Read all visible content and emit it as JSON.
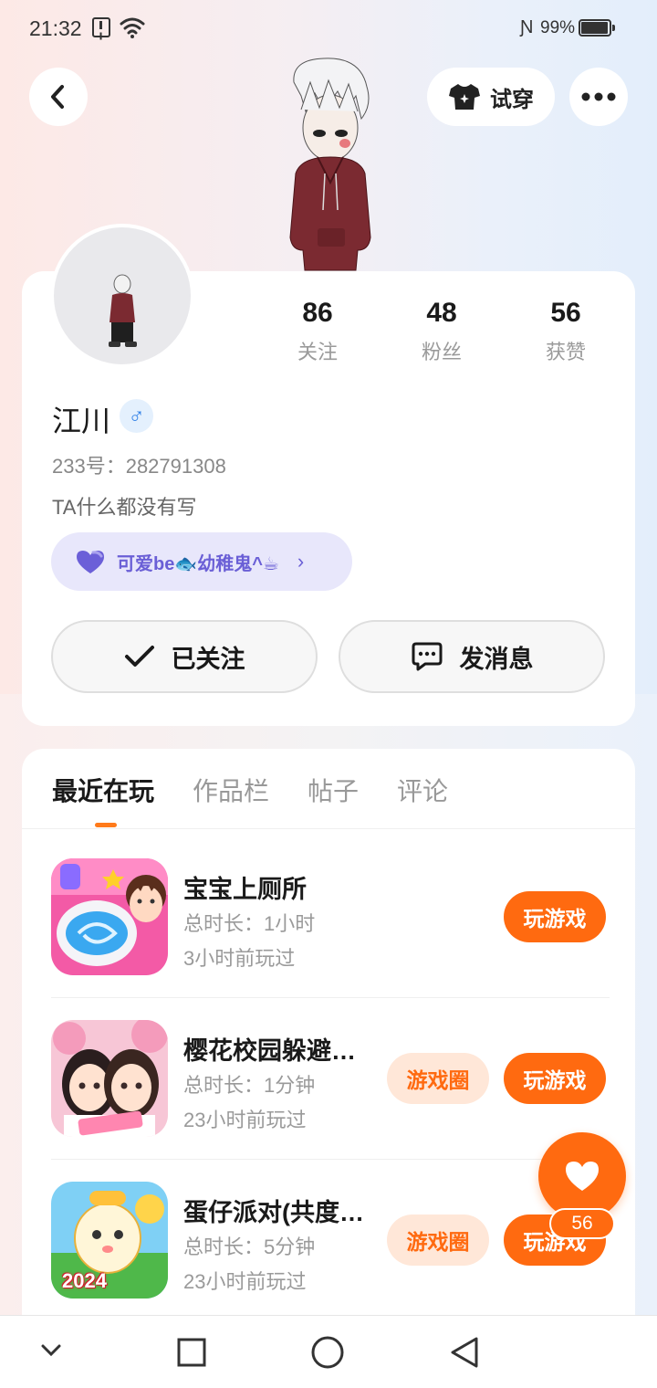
{
  "status_bar": {
    "time": "21:32",
    "battery": "99%"
  },
  "header": {
    "tryon_label": "试穿"
  },
  "profile": {
    "stats": [
      {
        "value": "86",
        "label": "关注"
      },
      {
        "value": "48",
        "label": "粉丝"
      },
      {
        "value": "56",
        "label": "获赞"
      }
    ],
    "username": "江川",
    "gender_symbol": "♂",
    "user_id": "233号：282791308",
    "bio": "TA什么都没有写",
    "tag": "可爱be🐟幼稚鬼^☕",
    "follow_label": "已关注",
    "message_label": "发消息"
  },
  "tabs": [
    {
      "label": "最近在玩"
    },
    {
      "label": "作品栏"
    },
    {
      "label": "帖子"
    },
    {
      "label": "评论"
    }
  ],
  "games": [
    {
      "title": "宝宝上厕所",
      "duration": "总时长：1小时",
      "last_played": "3小时前玩过",
      "play_label": "玩游戏",
      "circle_label": ""
    },
    {
      "title": "樱花校园躲避…",
      "duration": "总时长：1分钟",
      "last_played": "23小时前玩过",
      "play_label": "玩游戏",
      "circle_label": "游戏圈"
    },
    {
      "title": "蛋仔派对(共度…",
      "duration": "总时长：5分钟",
      "last_played": "23小时前玩过",
      "play_label": "玩游戏",
      "circle_label": "游戏圈",
      "icon_text": "2024"
    }
  ],
  "like": {
    "count": "56"
  },
  "colors": {
    "accent": "#ff6a10",
    "tag_bg": "#e8e7fb",
    "tag_text": "#6a5fd6"
  }
}
